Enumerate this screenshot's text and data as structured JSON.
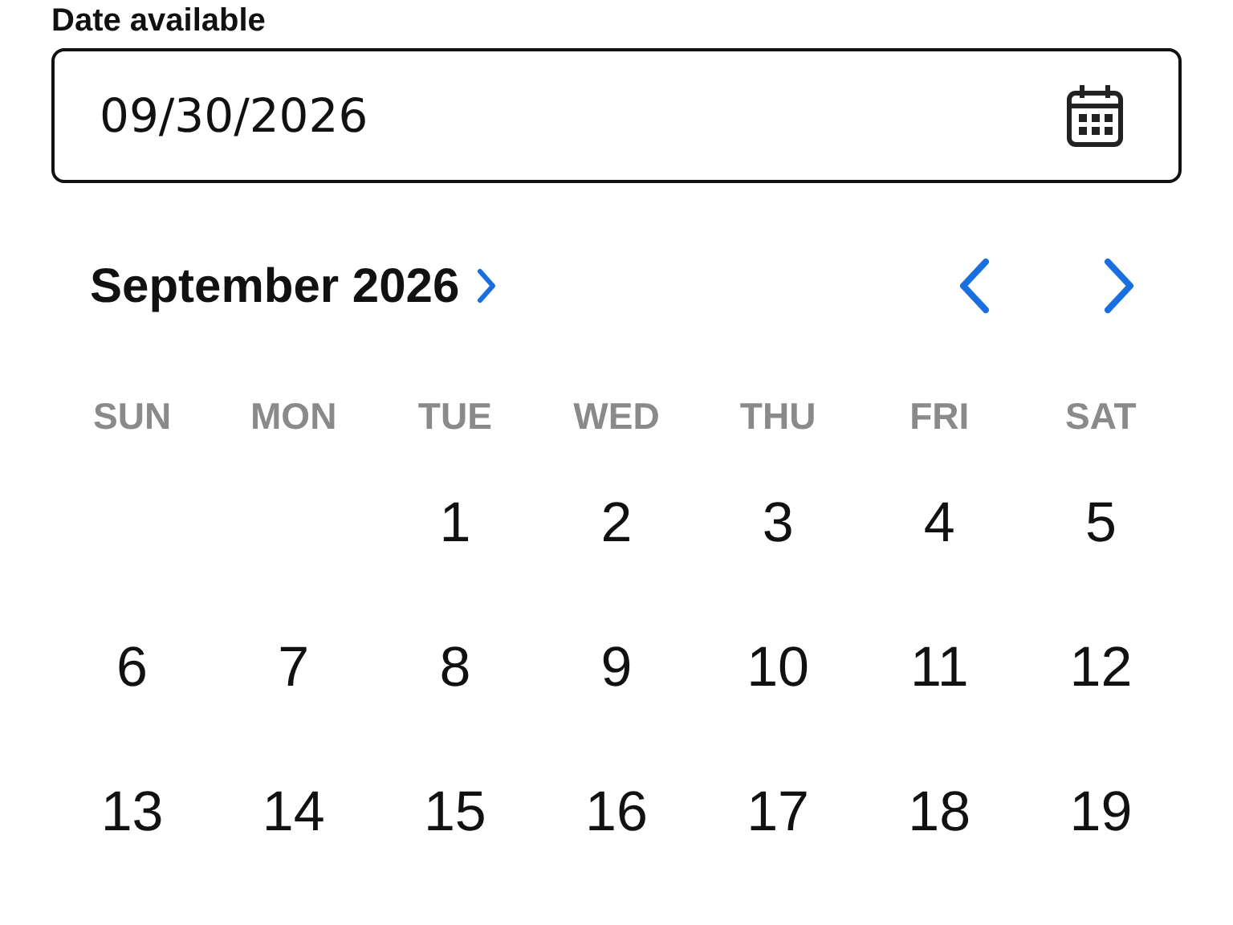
{
  "field": {
    "label": "Date available",
    "value": "09/30/2026"
  },
  "calendar": {
    "month": "September 2026",
    "weekdays": [
      "SUN",
      "MON",
      "TUE",
      "WED",
      "THU",
      "FRI",
      "SAT"
    ],
    "weeks": [
      [
        "1",
        "2",
        "3",
        "4",
        "5"
      ],
      [
        "6",
        "7",
        "8",
        "9",
        "10",
        "11",
        "12"
      ],
      [
        "13",
        "14",
        "15",
        "16",
        "17",
        "18",
        "19"
      ]
    ]
  }
}
